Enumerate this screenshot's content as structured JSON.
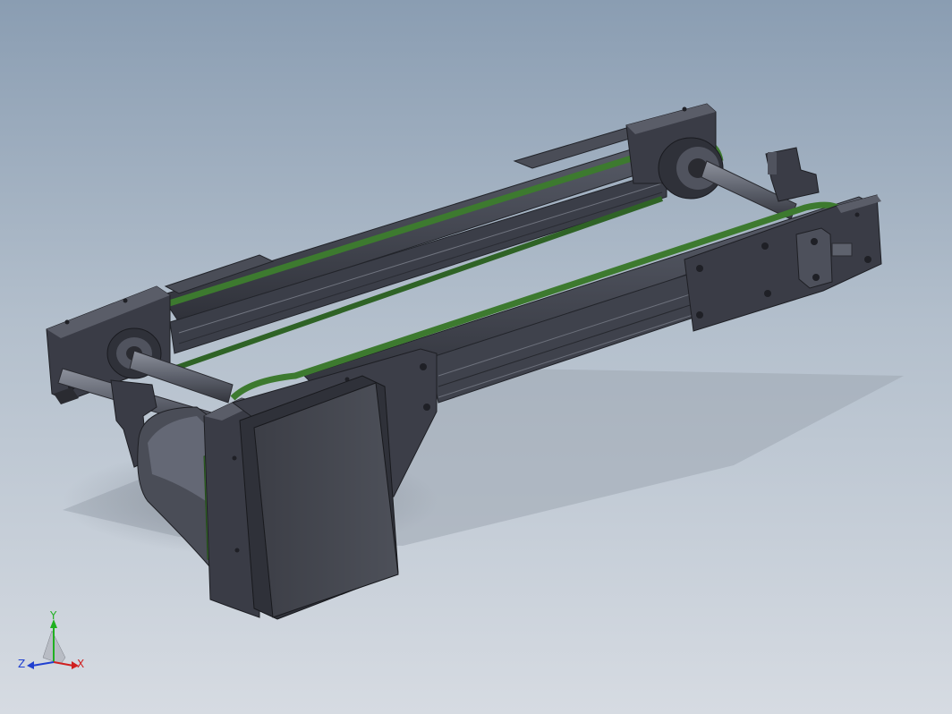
{
  "triad": {
    "x_label": "X",
    "y_label": "Y",
    "z_label": "Z"
  },
  "colors": {
    "background_top": "#8a9db2",
    "background_bottom": "#d6dbe2",
    "frame_dark": "#3a3c46",
    "frame_mid": "#50535f",
    "belt_green": "#3d7a2f",
    "belt_edge": "#254d1c",
    "motor_box": "#45474f",
    "shaft": "#6a6e78",
    "axis_x": "#d02020",
    "axis_y": "#20b020",
    "axis_z": "#2040d0"
  },
  "icons": {
    "triad": "coordinate-triad-icon"
  }
}
